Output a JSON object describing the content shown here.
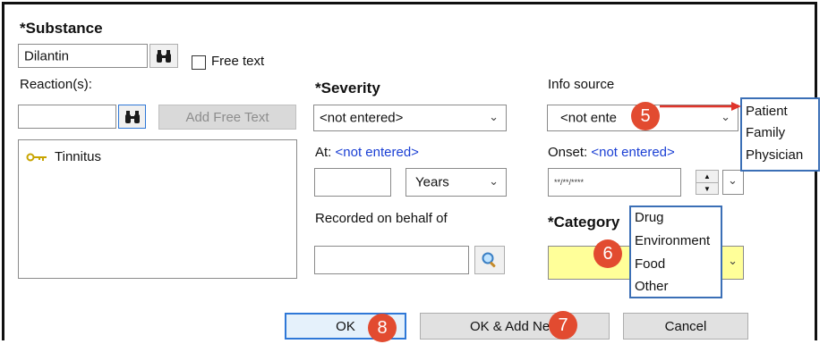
{
  "substance": {
    "label": "*Substance",
    "value": "Dilantin",
    "free_text_label": "Free text"
  },
  "reaction": {
    "label": "Reaction(s):",
    "add_free_text_label": "Add Free Text",
    "items": [
      "Tinnitus"
    ]
  },
  "severity": {
    "label": "*Severity",
    "value": "<not entered>",
    "at_label": "At:",
    "at_value": "<not entered>",
    "years_value": "Years",
    "recorded_label": "Recorded on behalf of"
  },
  "info_source": {
    "label": "Info source",
    "value": "<not ente",
    "options": [
      "Patient",
      "Family",
      "Physician"
    ]
  },
  "onset": {
    "label": "Onset:",
    "value": "<not entered>",
    "date_mask": "**/**/****"
  },
  "category": {
    "label": "*Category",
    "options": [
      "Drug",
      "Environment",
      "Food",
      "Other"
    ]
  },
  "buttons": {
    "ok": "OK",
    "ok_add_new": "OK & Add New",
    "cancel": "Cancel"
  },
  "callouts": [
    "5",
    "6",
    "7",
    "8"
  ],
  "colors": {
    "callout": "#e24b30",
    "highlight_border": "#3b6fb6",
    "category_fill": "#ffff99",
    "link": "#1a3fd4"
  }
}
